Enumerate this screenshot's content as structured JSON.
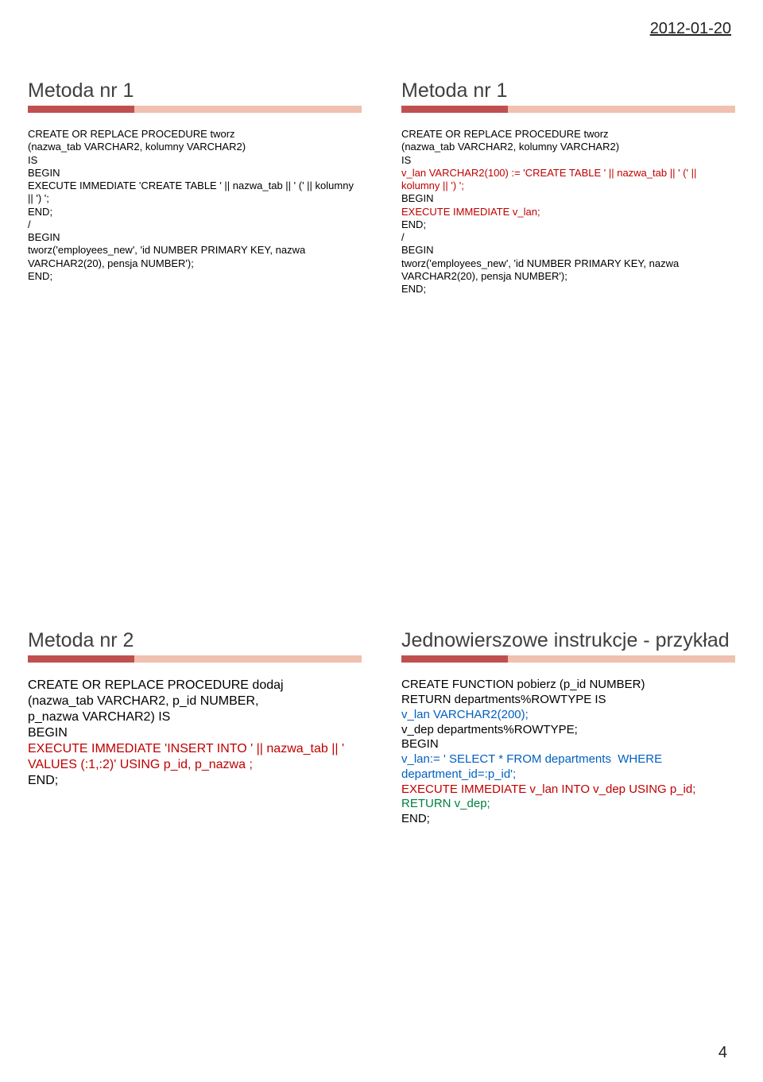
{
  "page": {
    "date": "2012-01-20",
    "number": "4"
  },
  "slides": [
    {
      "title": "Metoda nr 1",
      "lines": [
        {
          "cls": "black",
          "text": "CREATE OR REPLACE PROCEDURE tworz"
        },
        {
          "cls": "black",
          "text": "(nazwa_tab VARCHAR2, kolumny VARCHAR2)"
        },
        {
          "cls": "black",
          "text": "IS"
        },
        {
          "cls": "black",
          "text": "BEGIN"
        },
        {
          "cls": "black",
          "text": "EXECUTE IMMEDIATE 'CREATE TABLE ' || nazwa_tab || ' (' || kolumny || ') ';"
        },
        {
          "cls": "black",
          "text": "END;"
        },
        {
          "cls": "black",
          "text": "/"
        },
        {
          "cls": "black",
          "text": "BEGIN"
        },
        {
          "cls": "black",
          "text": "tworz('employees_new', 'id NUMBER PRIMARY KEY, nazwa VARCHAR2(20), pensja NUMBER');"
        },
        {
          "cls": "black",
          "text": "END;"
        }
      ]
    },
    {
      "title": "Metoda nr 1",
      "lines": [
        {
          "cls": "black",
          "text": "CREATE OR REPLACE PROCEDURE tworz"
        },
        {
          "cls": "black",
          "text": "(nazwa_tab VARCHAR2, kolumny VARCHAR2)"
        },
        {
          "cls": "black",
          "text": "IS"
        },
        {
          "cls": "red",
          "text": "v_lan VARCHAR2(100) := 'CREATE TABLE ' || nazwa_tab || ' (' || kolumny || ') ';"
        },
        {
          "cls": "black",
          "text": "BEGIN"
        },
        {
          "cls": "red",
          "text": "EXECUTE IMMEDIATE v_lan;"
        },
        {
          "cls": "black",
          "text": "END;"
        },
        {
          "cls": "black",
          "text": "/"
        },
        {
          "cls": "black",
          "text": "BEGIN"
        },
        {
          "cls": "black",
          "text": "tworz('employees_new', 'id NUMBER PRIMARY KEY, nazwa VARCHAR2(20), pensja NUMBER');"
        },
        {
          "cls": "black",
          "text": "END;"
        }
      ]
    },
    {
      "title": "Metoda nr 2",
      "lines": [
        {
          "cls": "black",
          "text": "CREATE OR REPLACE PROCEDURE dodaj"
        },
        {
          "cls": "black",
          "text": "(nazwa_tab VARCHAR2, p_id NUMBER,"
        },
        {
          "cls": "black",
          "text": "p_nazwa VARCHAR2) IS"
        },
        {
          "cls": "black",
          "text": "BEGIN"
        },
        {
          "cls": "red",
          "text": "EXECUTE IMMEDIATE 'INSERT INTO ' || nazwa_tab || ' VALUES (:1,:2)' USING p_id, p_nazwa ;"
        },
        {
          "cls": "black",
          "text": "END;"
        }
      ],
      "code_size": "16px"
    },
    {
      "title": "Jednowierszowe instrukcje - przykład",
      "lines": [
        {
          "cls": "black",
          "text": "CREATE FUNCTION pobierz (p_id NUMBER)"
        },
        {
          "cls": "black",
          "text": "RETURN departments%ROWTYPE IS"
        },
        {
          "cls": "blue",
          "text": "v_lan VARCHAR2(200);"
        },
        {
          "cls": "black",
          "text": "v_dep departments%ROWTYPE;"
        },
        {
          "cls": "black",
          "text": "BEGIN"
        },
        {
          "cls": "blue",
          "text": "v_lan:= ' SELECT * FROM departments  WHERE department_id=:p_id';"
        },
        {
          "cls": "red",
          "text": "EXECUTE IMMEDIATE v_lan INTO v_dep USING p_id;"
        },
        {
          "cls": "green",
          "text": "RETURN v_dep;"
        },
        {
          "cls": "black",
          "text": "END;"
        }
      ],
      "code_size": "15px"
    }
  ]
}
